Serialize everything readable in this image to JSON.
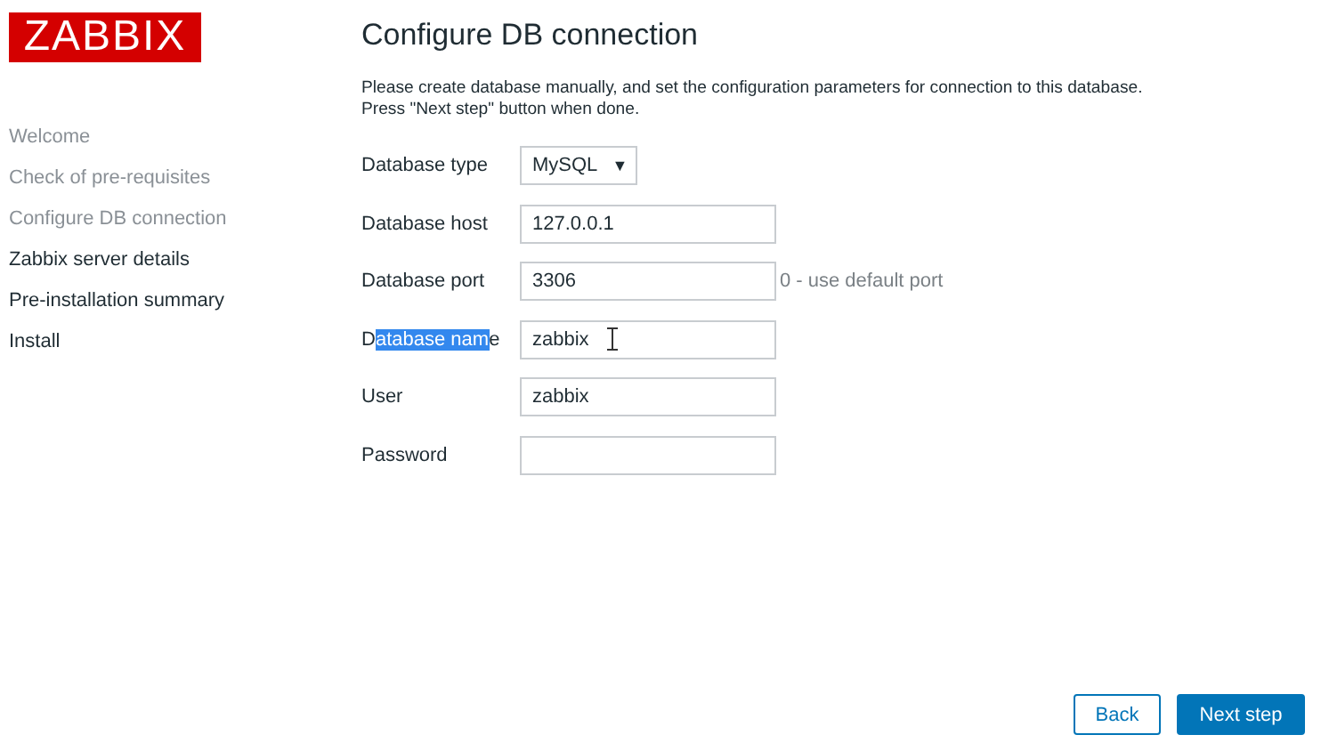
{
  "logo": "ZABBIX",
  "steps": [
    {
      "label": "Welcome",
      "completed": true
    },
    {
      "label": "Check of pre-requisites",
      "completed": true
    },
    {
      "label": "Configure DB connection",
      "completed": true
    },
    {
      "label": "Zabbix server details",
      "completed": false
    },
    {
      "label": "Pre-installation summary",
      "completed": false
    },
    {
      "label": "Install",
      "completed": false
    }
  ],
  "title": "Configure DB connection",
  "description": [
    "Please create database manually, and set the configuration parameters for connection to this database.",
    "Press \"Next step\" button when done."
  ],
  "fields": [
    {
      "kind": "select",
      "label": "Database type",
      "value": "MySQL",
      "caret": "▼"
    },
    {
      "kind": "text",
      "label": "Database host",
      "value": "127.0.0.1"
    },
    {
      "kind": "text",
      "label": "Database port",
      "value": "3306",
      "hint": "0 - use default port"
    },
    {
      "kind": "text",
      "label_parts": {
        "before": "D",
        "selected": "atabase nam",
        "after": "e"
      },
      "value": "zabbix",
      "cursor": true
    },
    {
      "kind": "text",
      "label": "User",
      "value": "zabbix"
    },
    {
      "kind": "password",
      "label": "Password"
    }
  ],
  "buttons": [
    {
      "label": "Back",
      "kind": "secondary"
    },
    {
      "label": "Next step",
      "kind": "primary"
    }
  ]
}
